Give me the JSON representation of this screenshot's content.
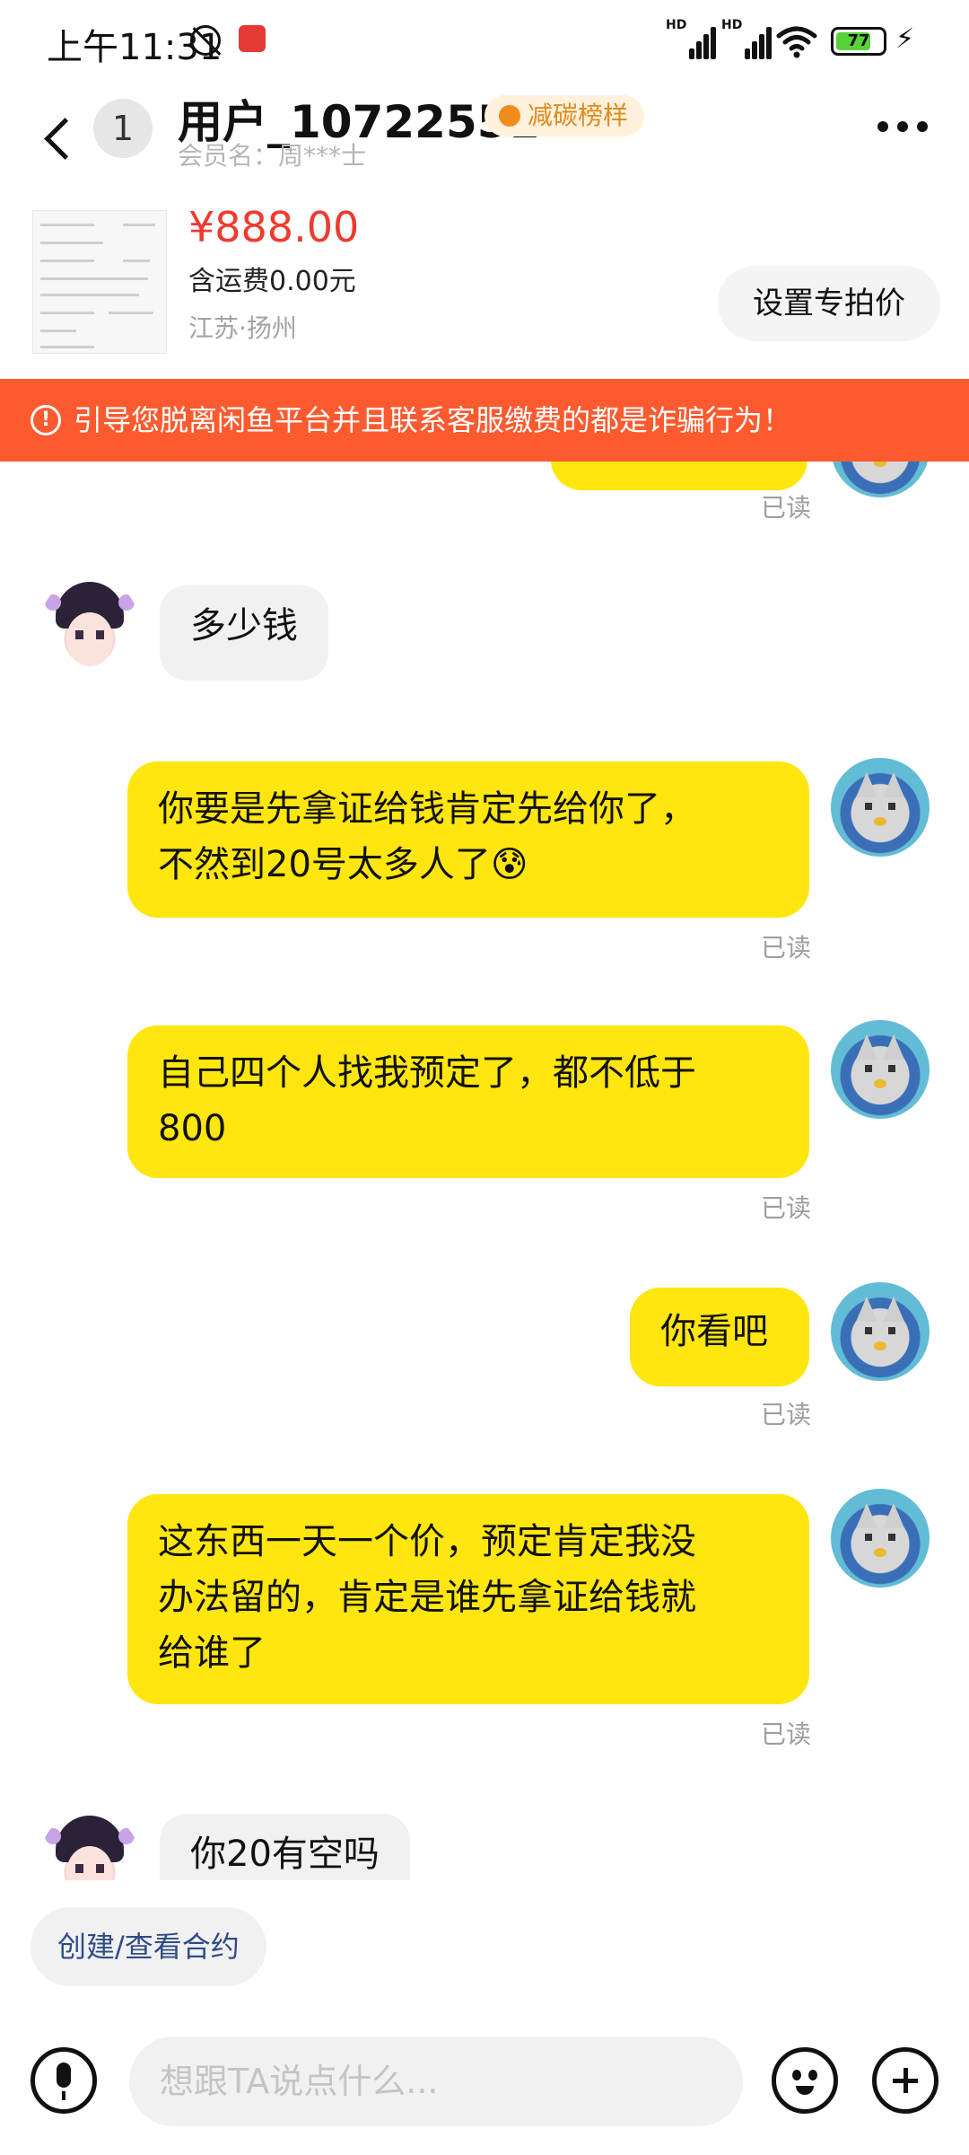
{
  "status_bar": {
    "time": "上午11:31",
    "battery": "77",
    "network_label": "HD"
  },
  "header": {
    "unread_count": "1",
    "username": "用户_10722551",
    "badge": "减碳榜样",
    "member_name": "会员名：周***士"
  },
  "product": {
    "price": "¥888.00",
    "shipping": "含运费0.00元",
    "location": "江苏·扬州",
    "set_price_button": "设置专拍价"
  },
  "warning": {
    "text": "引导您脱离闲鱼平台并且联系客服缴费的都是诈骗行为！"
  },
  "messages": [
    {
      "from": "them",
      "text": "多少钱"
    },
    {
      "from": "me",
      "text_line1": "你要是先拿证给钱肯定先给你了，",
      "text_line2": "不然到20号太多人了😰",
      "status": "已读"
    },
    {
      "from": "me",
      "text_line1": "自己四个人找我预定了，都不低于",
      "text_line2": "800",
      "status": "已读"
    },
    {
      "from": "me",
      "text": "你看吧",
      "status": "已读"
    },
    {
      "from": "me",
      "text_line1": "这东西一天一个价，预定肯定我没",
      "text_line2": "办法留的，肯定是谁先拿证给钱就",
      "text_line3": "给谁了",
      "status": "已读"
    },
    {
      "from": "them",
      "text": "你20有空吗"
    }
  ],
  "top_read_status": "已读",
  "contract_chip": "创建/查看合约",
  "input": {
    "placeholder": "想跟TA说点什么..."
  }
}
